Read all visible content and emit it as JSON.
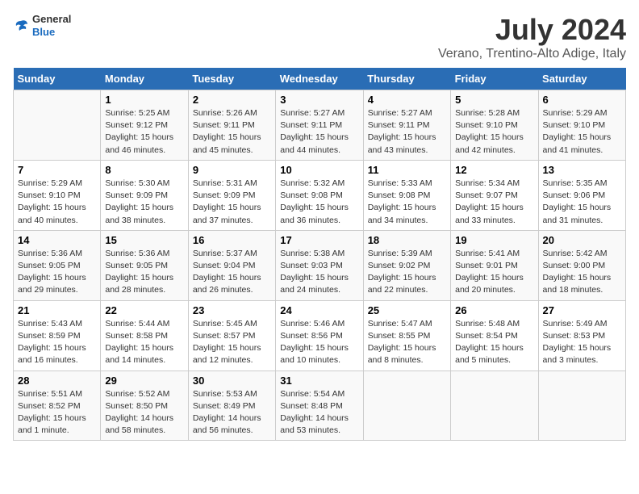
{
  "logo": {
    "text_general": "General",
    "text_blue": "Blue"
  },
  "title": "July 2024",
  "subtitle": "Verano, Trentino-Alto Adige, Italy",
  "header_days": [
    "Sunday",
    "Monday",
    "Tuesday",
    "Wednesday",
    "Thursday",
    "Friday",
    "Saturday"
  ],
  "weeks": [
    [
      {
        "day": "",
        "info": ""
      },
      {
        "day": "1",
        "info": "Sunrise: 5:25 AM\nSunset: 9:12 PM\nDaylight: 15 hours\nand 46 minutes."
      },
      {
        "day": "2",
        "info": "Sunrise: 5:26 AM\nSunset: 9:11 PM\nDaylight: 15 hours\nand 45 minutes."
      },
      {
        "day": "3",
        "info": "Sunrise: 5:27 AM\nSunset: 9:11 PM\nDaylight: 15 hours\nand 44 minutes."
      },
      {
        "day": "4",
        "info": "Sunrise: 5:27 AM\nSunset: 9:11 PM\nDaylight: 15 hours\nand 43 minutes."
      },
      {
        "day": "5",
        "info": "Sunrise: 5:28 AM\nSunset: 9:10 PM\nDaylight: 15 hours\nand 42 minutes."
      },
      {
        "day": "6",
        "info": "Sunrise: 5:29 AM\nSunset: 9:10 PM\nDaylight: 15 hours\nand 41 minutes."
      }
    ],
    [
      {
        "day": "7",
        "info": "Sunrise: 5:29 AM\nSunset: 9:10 PM\nDaylight: 15 hours\nand 40 minutes."
      },
      {
        "day": "8",
        "info": "Sunrise: 5:30 AM\nSunset: 9:09 PM\nDaylight: 15 hours\nand 38 minutes."
      },
      {
        "day": "9",
        "info": "Sunrise: 5:31 AM\nSunset: 9:09 PM\nDaylight: 15 hours\nand 37 minutes."
      },
      {
        "day": "10",
        "info": "Sunrise: 5:32 AM\nSunset: 9:08 PM\nDaylight: 15 hours\nand 36 minutes."
      },
      {
        "day": "11",
        "info": "Sunrise: 5:33 AM\nSunset: 9:08 PM\nDaylight: 15 hours\nand 34 minutes."
      },
      {
        "day": "12",
        "info": "Sunrise: 5:34 AM\nSunset: 9:07 PM\nDaylight: 15 hours\nand 33 minutes."
      },
      {
        "day": "13",
        "info": "Sunrise: 5:35 AM\nSunset: 9:06 PM\nDaylight: 15 hours\nand 31 minutes."
      }
    ],
    [
      {
        "day": "14",
        "info": "Sunrise: 5:36 AM\nSunset: 9:05 PM\nDaylight: 15 hours\nand 29 minutes."
      },
      {
        "day": "15",
        "info": "Sunrise: 5:36 AM\nSunset: 9:05 PM\nDaylight: 15 hours\nand 28 minutes."
      },
      {
        "day": "16",
        "info": "Sunrise: 5:37 AM\nSunset: 9:04 PM\nDaylight: 15 hours\nand 26 minutes."
      },
      {
        "day": "17",
        "info": "Sunrise: 5:38 AM\nSunset: 9:03 PM\nDaylight: 15 hours\nand 24 minutes."
      },
      {
        "day": "18",
        "info": "Sunrise: 5:39 AM\nSunset: 9:02 PM\nDaylight: 15 hours\nand 22 minutes."
      },
      {
        "day": "19",
        "info": "Sunrise: 5:41 AM\nSunset: 9:01 PM\nDaylight: 15 hours\nand 20 minutes."
      },
      {
        "day": "20",
        "info": "Sunrise: 5:42 AM\nSunset: 9:00 PM\nDaylight: 15 hours\nand 18 minutes."
      }
    ],
    [
      {
        "day": "21",
        "info": "Sunrise: 5:43 AM\nSunset: 8:59 PM\nDaylight: 15 hours\nand 16 minutes."
      },
      {
        "day": "22",
        "info": "Sunrise: 5:44 AM\nSunset: 8:58 PM\nDaylight: 15 hours\nand 14 minutes."
      },
      {
        "day": "23",
        "info": "Sunrise: 5:45 AM\nSunset: 8:57 PM\nDaylight: 15 hours\nand 12 minutes."
      },
      {
        "day": "24",
        "info": "Sunrise: 5:46 AM\nSunset: 8:56 PM\nDaylight: 15 hours\nand 10 minutes."
      },
      {
        "day": "25",
        "info": "Sunrise: 5:47 AM\nSunset: 8:55 PM\nDaylight: 15 hours\nand 8 minutes."
      },
      {
        "day": "26",
        "info": "Sunrise: 5:48 AM\nSunset: 8:54 PM\nDaylight: 15 hours\nand 5 minutes."
      },
      {
        "day": "27",
        "info": "Sunrise: 5:49 AM\nSunset: 8:53 PM\nDaylight: 15 hours\nand 3 minutes."
      }
    ],
    [
      {
        "day": "28",
        "info": "Sunrise: 5:51 AM\nSunset: 8:52 PM\nDaylight: 15 hours\nand 1 minute."
      },
      {
        "day": "29",
        "info": "Sunrise: 5:52 AM\nSunset: 8:50 PM\nDaylight: 14 hours\nand 58 minutes."
      },
      {
        "day": "30",
        "info": "Sunrise: 5:53 AM\nSunset: 8:49 PM\nDaylight: 14 hours\nand 56 minutes."
      },
      {
        "day": "31",
        "info": "Sunrise: 5:54 AM\nSunset: 8:48 PM\nDaylight: 14 hours\nand 53 minutes."
      },
      {
        "day": "",
        "info": ""
      },
      {
        "day": "",
        "info": ""
      },
      {
        "day": "",
        "info": ""
      }
    ]
  ]
}
